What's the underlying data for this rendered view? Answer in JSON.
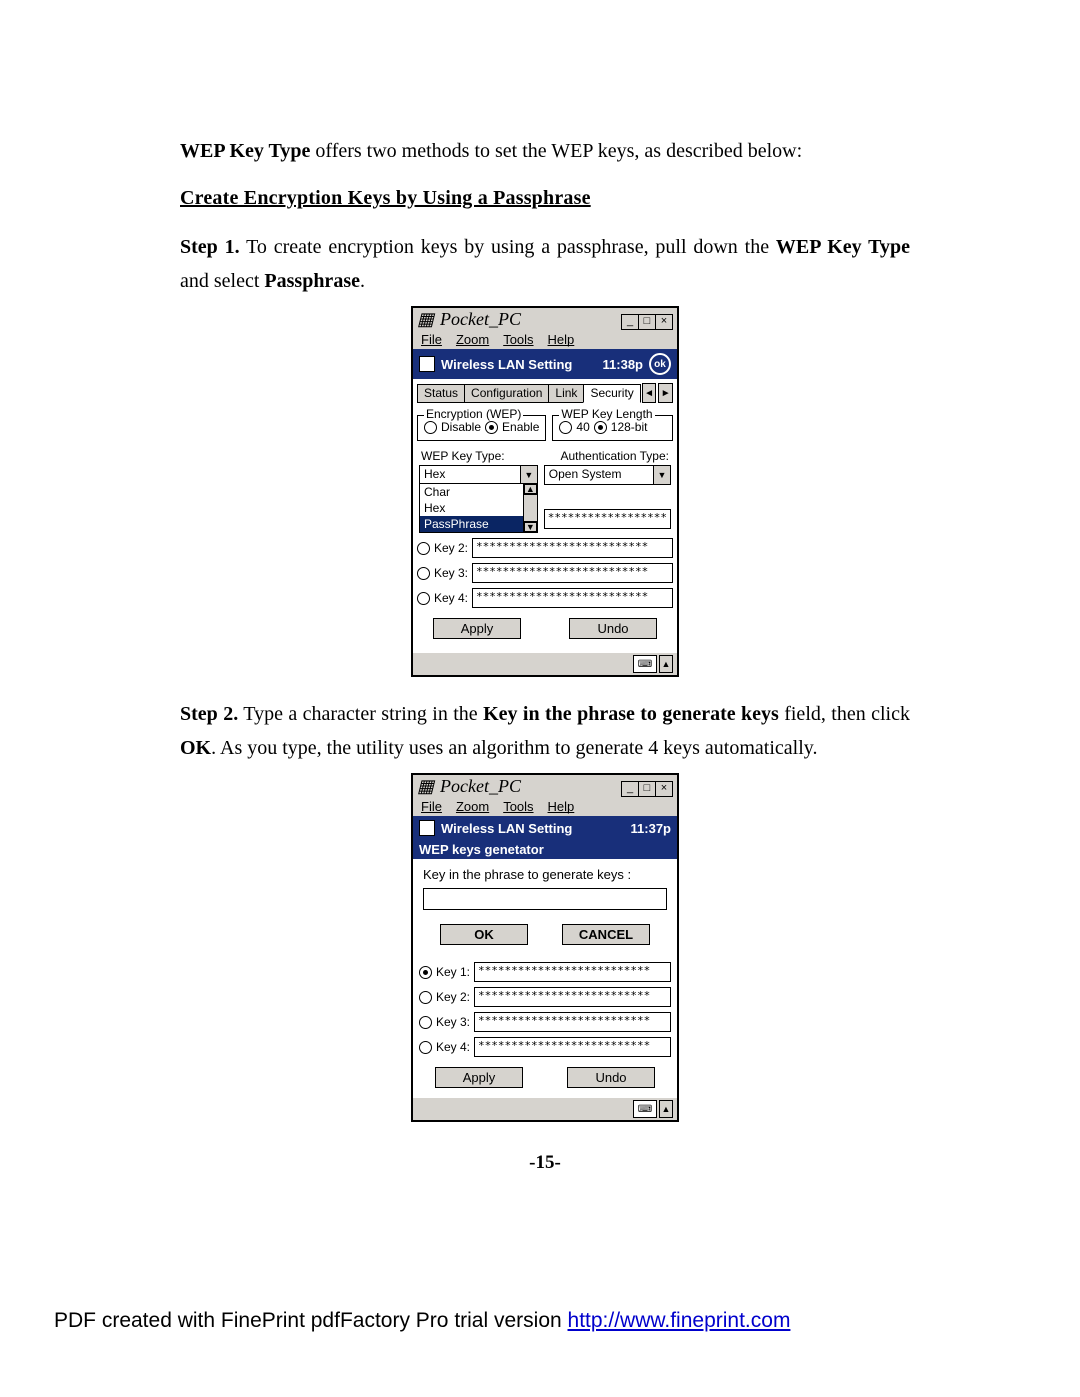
{
  "intro": {
    "bold": "WEP Key Type",
    "rest": " offers two methods to set the WEP keys, as described below:"
  },
  "heading": "Create Encryption Keys by Using a Passphrase    ",
  "step1": {
    "label": "Step 1.",
    "t1": " To create encryption keys by using a passphrase, pull down the ",
    "b1": "WEP Key Type",
    "t2": " and select ",
    "b2": "Passphrase",
    "t3": "."
  },
  "step2": {
    "label": "Step 2.",
    "t1": " Type a character string in the ",
    "b1": "Key in the phrase to generate keys",
    "t2": " field, then click ",
    "b2": "OK",
    "t3": ".    As you type, the utility uses an algorithm to generate 4 keys automatically."
  },
  "pocket1": {
    "winTitle": "Pocket_PC",
    "menu": {
      "file": "File",
      "zoom": "Zoom",
      "tools": "Tools",
      "help": "Help"
    },
    "blue": {
      "title": "Wireless LAN Setting",
      "time": "11:38p",
      "ok": "ok"
    },
    "tabs": {
      "status": "Status",
      "config": "Configuration",
      "link": "Link",
      "security": "Security"
    },
    "encGroup": "Encryption (WEP)",
    "encDisable": "Disable",
    "encEnable": "Enable",
    "lenGroup": "WEP Key Length",
    "len40": "40",
    "len128": "128-bit",
    "wepKeyTypeLabel": "WEP Key Type:",
    "authTypeLabel": "Authentication Type:",
    "wepKeyTypeVal": "Hex",
    "authTypeVal": "Open System",
    "ddChar": "Char",
    "ddHex": "Hex",
    "ddPass": "PassPhrase",
    "keys": {
      "k2": "Key 2:",
      "k3": "Key 3:",
      "k4": "Key 4:",
      "mask": "**************************",
      "shortmask": "******************"
    },
    "apply": "Apply",
    "undo": "Undo"
  },
  "pocket2": {
    "winTitle": "Pocket_PC",
    "menu": {
      "file": "File",
      "zoom": "Zoom",
      "tools": "Tools",
      "help": "Help"
    },
    "blue": {
      "title": "Wireless LAN Setting",
      "time": "11:37p"
    },
    "sub": "WEP keys genetator",
    "prompt": "Key in the phrase to generate keys :",
    "ok": "OK",
    "cancel": "CANCEL",
    "keys": {
      "k1": "Key 1:",
      "k2": "Key 2:",
      "k3": "Key 3:",
      "k4": "Key 4:",
      "mask": "**************************"
    },
    "apply": "Apply",
    "undo": "Undo"
  },
  "pageNum": "-15-",
  "footer": {
    "text": "PDF created with FinePrint pdfFactory Pro trial version ",
    "linkText": "http://www.fineprint.com"
  }
}
